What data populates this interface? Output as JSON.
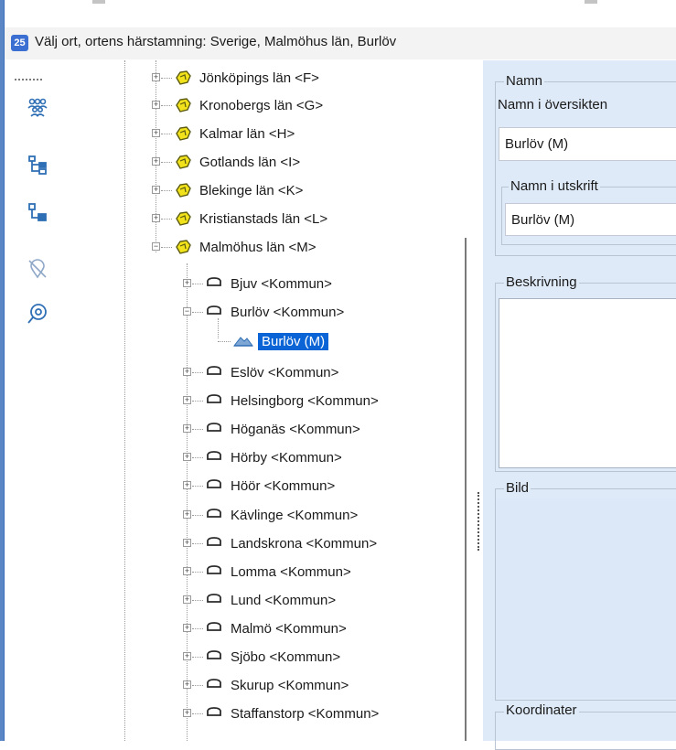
{
  "window": {
    "title": "Välj ort, ortens härstamning: Sverige, Malmöhus län, Burlöv"
  },
  "tree": {
    "counties": [
      {
        "label": "Jönköpings län <F>"
      },
      {
        "label": "Kronobergs län <G>"
      },
      {
        "label": "Kalmar län <H>"
      },
      {
        "label": "Gotlands län <I>"
      },
      {
        "label": "Blekinge län <K>"
      },
      {
        "label": "Kristianstads län <L>"
      },
      {
        "label": "Malmöhus län <M>"
      }
    ],
    "municipalities": [
      {
        "label": "Bjuv <Kommun>"
      },
      {
        "label": "Burlöv <Kommun>"
      },
      {
        "label": "Eslöv <Kommun>"
      },
      {
        "label": "Helsingborg <Kommun>"
      },
      {
        "label": "Höganäs <Kommun>"
      },
      {
        "label": "Hörby <Kommun>"
      },
      {
        "label": "Höör <Kommun>"
      },
      {
        "label": "Kävlinge <Kommun>"
      },
      {
        "label": "Landskrona <Kommun>"
      },
      {
        "label": "Lomma <Kommun>"
      },
      {
        "label": "Lund <Kommun>"
      },
      {
        "label": "Malmö <Kommun>"
      },
      {
        "label": "Sjöbo <Kommun>"
      },
      {
        "label": "Skurup <Kommun>"
      },
      {
        "label": "Staffanstorp <Kommun>"
      }
    ],
    "selected_place": "Burlöv (M)"
  },
  "details": {
    "namn_group": "Namn",
    "namn_oversikt_label": "Namn i översikten",
    "namn_oversikt_value": "Burlöv (M)",
    "namn_utskrift_group": "Namn i utskrift",
    "namn_utskrift_value": "Burlöv (M)",
    "beskrivning_label": "Beskrivning",
    "bild_label": "Bild",
    "koordinater_label": "Koordinater"
  },
  "colors": {
    "selection": "#0a64d6",
    "panel_bg": "#dfeaf8",
    "accent_icon": "#2f6fb5",
    "county_icon": "#f1e21b"
  },
  "icons": {
    "app": "app-icon",
    "people": "people-icon",
    "hierarchy": "hierarchy-icon",
    "branch": "branch-icon",
    "location_off": "location-off-icon",
    "location_search": "location-search-icon"
  }
}
